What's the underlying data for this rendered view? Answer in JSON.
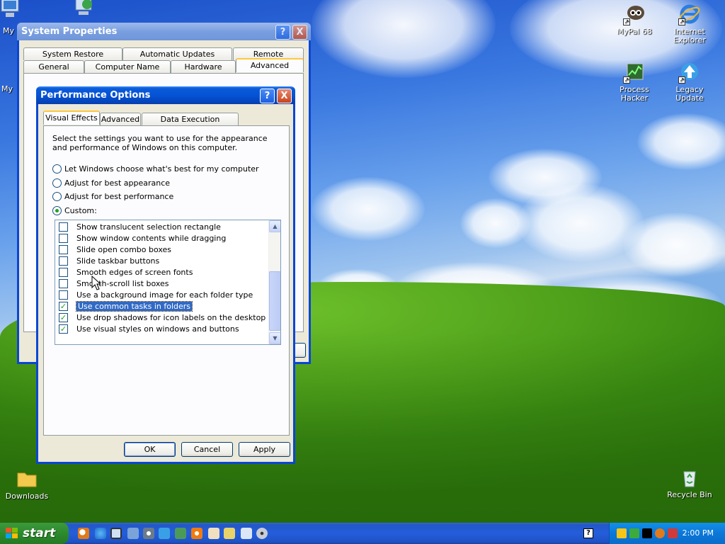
{
  "desktop": {
    "icons": [
      {
        "label": "My",
        "name": "my-computer-icon"
      },
      {
        "label": "My",
        "name": "my-documents-icon"
      },
      {
        "label": "MyPal 68",
        "name": "mypal-icon"
      },
      {
        "label": "Internet Explorer",
        "name": "internet-explorer-icon"
      },
      {
        "label": "Process Hacker",
        "name": "process-hacker-icon"
      },
      {
        "label": "Legacy Update",
        "name": "legacy-update-icon"
      },
      {
        "label": "Downloads",
        "name": "folder-icon"
      },
      {
        "label": "Recycle Bin",
        "name": "recycle-bin-icon"
      }
    ]
  },
  "system_properties": {
    "title": "System Properties",
    "tabs_row1": [
      "System Restore",
      "Automatic Updates",
      "Remote"
    ],
    "tabs_row2": [
      "General",
      "Computer Name",
      "Hardware",
      "Advanced"
    ],
    "active_tab": "Advanced"
  },
  "performance_options": {
    "title": "Performance Options",
    "tabs": [
      "Visual Effects",
      "Advanced",
      "Data Execution Prevention"
    ],
    "active_tab": "Visual Effects",
    "description": "Select the settings you want to use for the appearance and performance of Windows on this computer.",
    "radios": [
      {
        "label": "Let Windows choose what's best for my computer",
        "checked": false
      },
      {
        "label": "Adjust for best appearance",
        "checked": false
      },
      {
        "label": "Adjust for best performance",
        "checked": false
      },
      {
        "label": "Custom:",
        "checked": true
      }
    ],
    "effects": [
      {
        "label": "Show translucent selection rectangle",
        "checked": false,
        "selected": false
      },
      {
        "label": "Show window contents while dragging",
        "checked": false,
        "selected": false
      },
      {
        "label": "Slide open combo boxes",
        "checked": false,
        "selected": false
      },
      {
        "label": "Slide taskbar buttons",
        "checked": false,
        "selected": false
      },
      {
        "label": "Smooth edges of screen fonts",
        "checked": false,
        "selected": false
      },
      {
        "label": "Smooth-scroll list boxes",
        "checked": false,
        "selected": false
      },
      {
        "label": "Use a background image for each folder type",
        "checked": false,
        "selected": false
      },
      {
        "label": "Use common tasks in folders",
        "checked": true,
        "selected": true
      },
      {
        "label": "Use drop shadows for icon labels on the desktop",
        "checked": true,
        "selected": false
      },
      {
        "label": "Use visual styles on windows and buttons",
        "checked": true,
        "selected": false
      }
    ],
    "buttons": {
      "ok": "OK",
      "cancel": "Cancel",
      "apply": "Apply"
    },
    "help_glyph": "?",
    "close_glyph": "X"
  },
  "taskbar": {
    "start_label": "start",
    "clock": "2:00 PM",
    "help_glyph": "?"
  },
  "colors": {
    "title_active": "#0553d6",
    "selection": "#316ac5",
    "dialog_face": "#ece9d8",
    "taskbar": "#245edb",
    "start_green": "#2d8a2d"
  }
}
